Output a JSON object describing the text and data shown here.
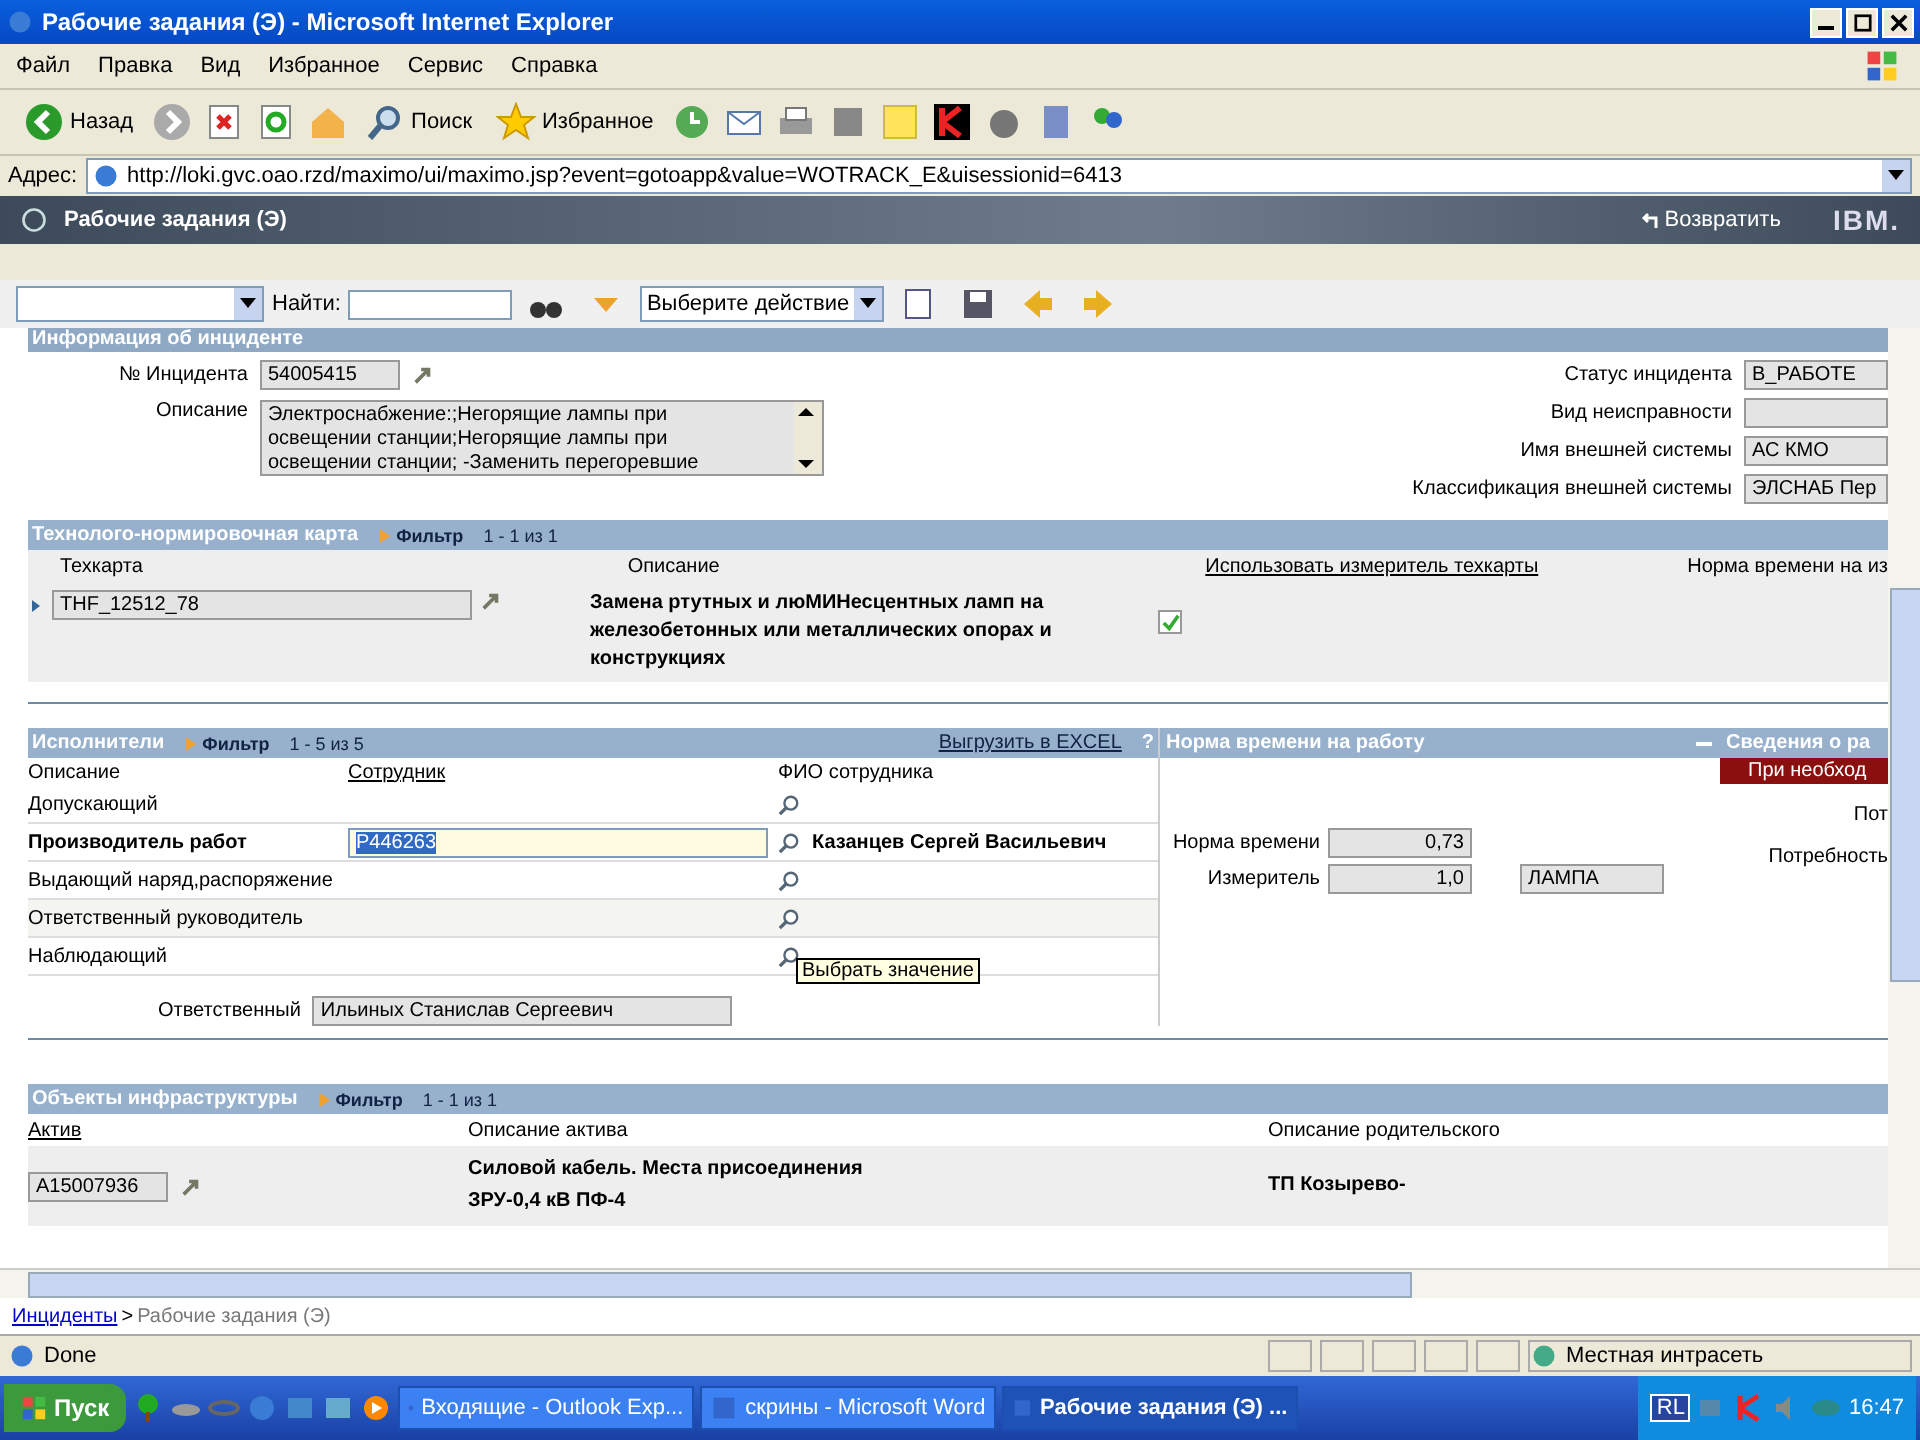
{
  "window": {
    "title": "Рабочие задания (Э) - Microsoft Internet Explorer"
  },
  "menu": [
    "Файл",
    "Правка",
    "Вид",
    "Избранное",
    "Сервис",
    "Справка"
  ],
  "toolbar": {
    "back": "Назад",
    "search": "Поиск",
    "favorites": "Избранное"
  },
  "address": {
    "label": "Адрес:",
    "url": "http://loki.gvc.oao.rzd/maximo/ui/maximo.jsp?event=gotoapp&value=WOTRACK_E&uisessionid=6413"
  },
  "app": {
    "title": "Рабочие задания (Э)",
    "return": "Возвратить",
    "brand": "IBM."
  },
  "app_toolbar": {
    "find_label": "Найти:",
    "action": "Выберите действие"
  },
  "incident": {
    "title": "Информация об инциденте",
    "number_label": "№ Инцидента",
    "number": "54005415",
    "description_label": "Описание",
    "description_lines": [
      "Электроснабжение:;Негорящие лампы при",
      "освещении станции;Негорящие лампы при",
      "освещении станции; -Заменить перегоревшие"
    ],
    "right_fields": [
      {
        "label": "Статус инцидента",
        "value": "В_РАБОТЕ"
      },
      {
        "label": "Вид неисправности"
      },
      {
        "label": "Имя внешней системы",
        "value": "АС КМО"
      },
      {
        "label": "Классификация внешней системы",
        "value": "ЭЛСНАБ Пер"
      }
    ]
  },
  "techcard": {
    "title": "Технолого-нормировочная карта",
    "filter": "Фильтр",
    "pager": "1 - 1 из 1",
    "columns": [
      "Техкарта",
      "Описание",
      "Использовать измеритель техкарты",
      "Норма времени на из"
    ],
    "rows": [
      {
        "card": "ТНF_12512_78",
        "description": "Замена ртутных и люМИНесцентных ламп на железобетонных или металлических опорах и конструкциях",
        "use_meter": true
      }
    ]
  },
  "executors": {
    "title": "Исполнители",
    "filter": "Фильтр",
    "pager": "1 - 5 из 5",
    "export": "Выгрузить в EXCEL",
    "help": "?",
    "columns": [
      "Описание",
      "Сотрудник",
      "ФИО сотрудника"
    ],
    "rows": [
      {
        "role": "Допускающий",
        "selected": false
      },
      {
        "role": "Производитель работ",
        "employee": "P446263",
        "name": "Казанцев Сергей Васильевич",
        "selected": true
      },
      {
        "role": "Выдающий наряд,распоряжение",
        "selected": false
      },
      {
        "role": "Ответственный руководитель",
        "selected": false
      },
      {
        "role": "Наблюдающий",
        "selected": false
      }
    ],
    "tooltip": "Выбрать значение",
    "responsible_label": "Ответственный",
    "responsible": "Ильиных Станислав Сергеевич"
  },
  "norm": {
    "title": "Норма времени на работу",
    "fields": [
      {
        "label": "Норма времени",
        "value": "0,73"
      },
      {
        "label": "Измеритель",
        "value": "1,0",
        "unit": "ЛАМПА"
      }
    ]
  },
  "details": {
    "title": "Сведения о ра",
    "button": "При необход",
    "labels": [
      "Пот",
      "Потребность"
    ]
  },
  "infrastructure": {
    "title": "Объекты инфраструктуры",
    "filter": "Фильтр",
    "pager": "1 - 1 из 1",
    "columns": [
      "Актив",
      "Описание актива",
      "Описание родительского"
    ],
    "rows": [
      {
        "asset": "A15007936",
        "description_lines": [
          "Силовой кабель. Места присоединения",
          "ЗРУ-0,4 кВ ПФ-4"
        ],
        "parent": "ТП Козырево-"
      }
    ]
  },
  "breadcrumb": {
    "link": "Инциденты",
    "separator": ">",
    "current": "Рабочие задания (Э)"
  },
  "status_bar": {
    "text": "Done",
    "zone": "Местная интрасеть"
  },
  "taskbar": {
    "start": "Пуск",
    "tasks": [
      {
        "label": "Входящие - Outlook Exp...",
        "selected": false
      },
      {
        "label": "скрины - Microsoft Word",
        "selected": false
      },
      {
        "label": "Рабочие задания (Э) ...",
        "selected": true
      }
    ],
    "lang": "RL",
    "clock": "16:47"
  }
}
